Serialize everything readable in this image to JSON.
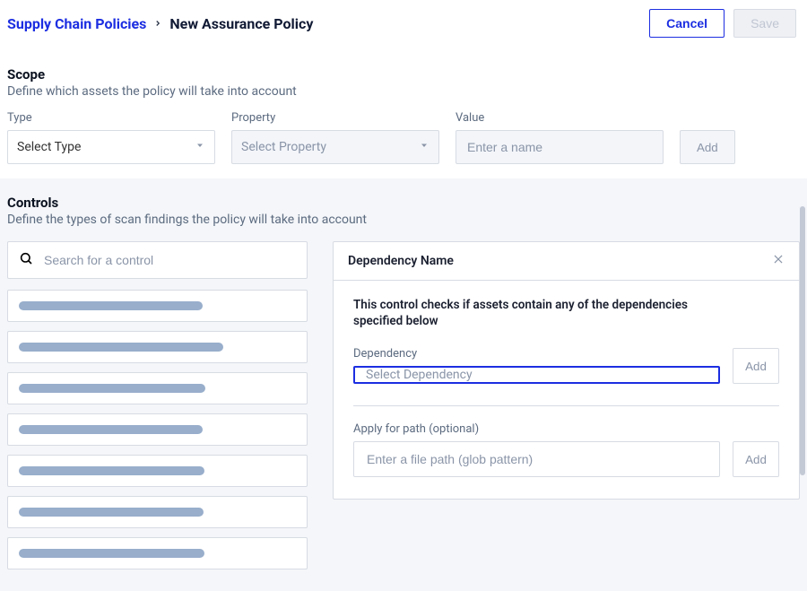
{
  "header": {
    "breadcrumb_root": "Supply Chain Policies",
    "breadcrumb_current": "New Assurance Policy",
    "cancel_label": "Cancel",
    "save_label": "Save"
  },
  "scope": {
    "title": "Scope",
    "subtitle": "Define which assets the policy will take into account",
    "type_label": "Type",
    "type_placeholder": "Select Type",
    "property_label": "Property",
    "property_placeholder": "Select Property",
    "value_label": "Value",
    "value_placeholder": "Enter a name",
    "add_label": "Add"
  },
  "controls": {
    "title": "Controls",
    "subtitle": "Define the types of scan findings the policy will take into account",
    "search_placeholder": "Search for a control",
    "list_bar_widths": [
      205,
      228,
      208,
      205,
      207,
      206,
      207
    ],
    "panel": {
      "title": "Dependency Name",
      "description": "This control checks if assets contain any of the dependencies specified below",
      "dependency_label": "Dependency",
      "dependency_placeholder": "Select Dependency",
      "dependency_add_label": "Add",
      "path_label": "Apply for path (optional)",
      "path_placeholder": "Enter a file path (glob pattern)",
      "path_add_label": "Add"
    }
  }
}
